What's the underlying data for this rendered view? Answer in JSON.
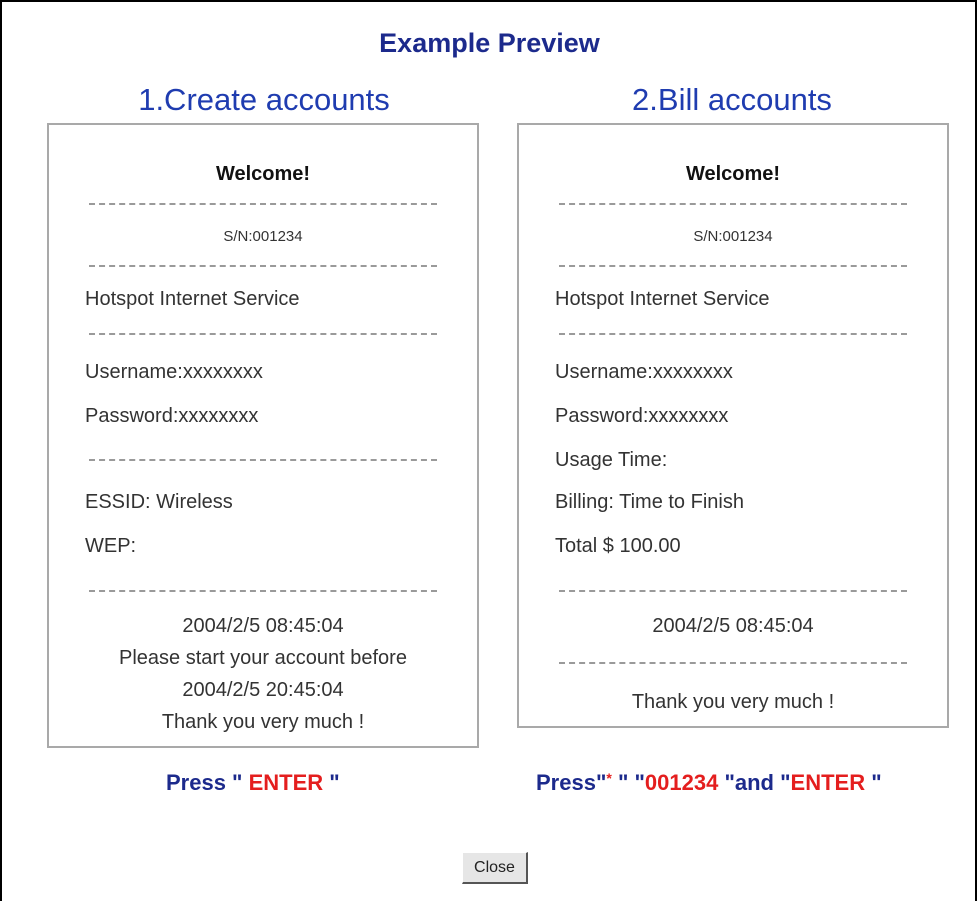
{
  "title": "Example Preview",
  "panels": [
    {
      "heading": "1.Create accounts",
      "welcome": "Welcome!",
      "sn": "S/N:001234",
      "service": "Hotspot Internet Service",
      "username": "Username:xxxxxxxx",
      "password": "Password:xxxxxxxx",
      "essid": "ESSID: Wireless",
      "wep": "WEP:",
      "datetime": "2004/2/5 08:45:04",
      "notice": "Please start your account before",
      "deadline": "2004/2/5 20:45:04",
      "thanks": "Thank you very much !"
    },
    {
      "heading": "2.Bill accounts",
      "welcome": "Welcome!",
      "sn": "S/N:001234",
      "service": "Hotspot Internet Service",
      "username": "Username:xxxxxxxx",
      "password": "Password:xxxxxxxx",
      "usage": "Usage Time:",
      "billing": "Billing: Time to Finish",
      "total": "Total $ 100.00",
      "datetime": "2004/2/5 08:45:04",
      "thanks": "Thank you very much !"
    }
  ],
  "instructions": {
    "left": {
      "prefix": "Press \" ",
      "key": "ENTER",
      "suffix": " \""
    },
    "right": {
      "prefix": "Press\"",
      "star": "*",
      "mid": " \" \"",
      "code": "001234",
      "and": " \"and \"",
      "key": "ENTER",
      "suffix": " \""
    }
  },
  "close_label": "Close",
  "colors": {
    "title": "#1c2a8c",
    "heading": "#1f3cb0",
    "highlight": "#e41e1e"
  }
}
